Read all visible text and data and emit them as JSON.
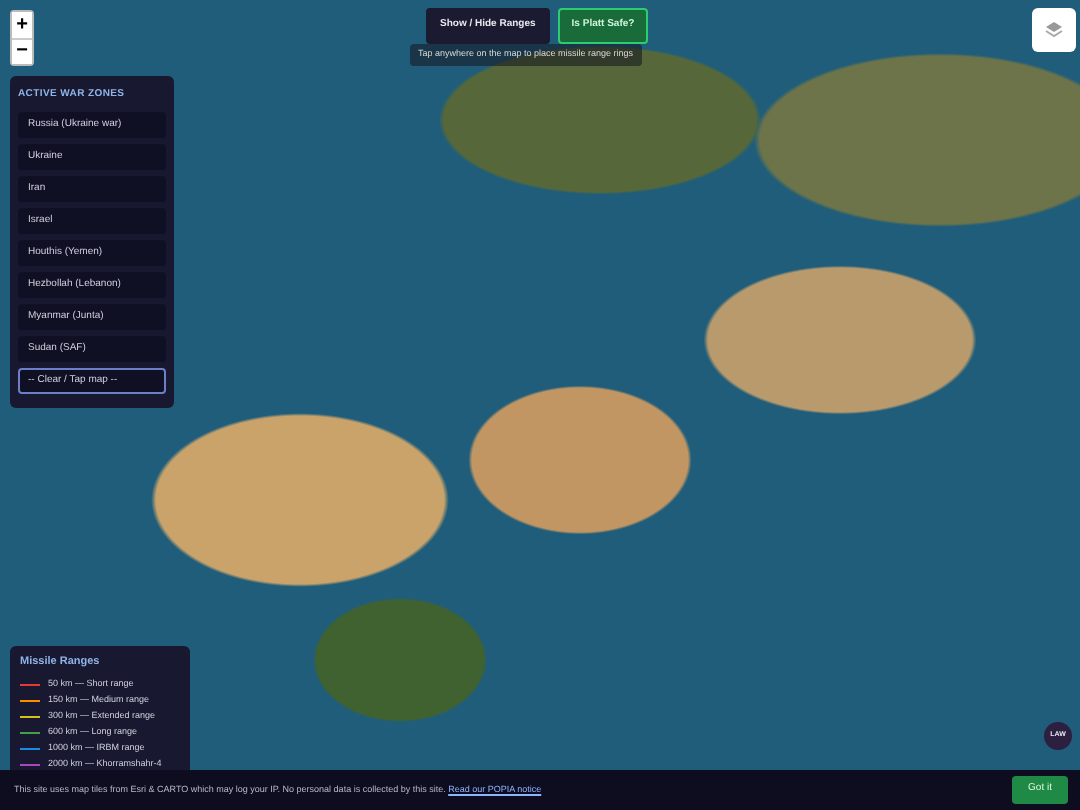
{
  "zoom_controls": [
    "+",
    "−"
  ],
  "top_buttons": [
    {
      "label": "Show / Hide Ranges",
      "kind": "plain"
    },
    {
      "label": "Is Platt Safe?",
      "kind": "green"
    }
  ],
  "hint": "Tap anywhere on the map to place missile range rings",
  "war_zones": {
    "title": "ACTIVE WAR ZONES",
    "items": [
      {
        "label": "Russia (Ukraine war)",
        "selected": false
      },
      {
        "label": "Ukraine",
        "selected": false
      },
      {
        "label": "Iran",
        "selected": false
      },
      {
        "label": "Israel",
        "selected": false
      },
      {
        "label": "Houthis (Yemen)",
        "selected": false
      },
      {
        "label": "Hezbollah (Lebanon)",
        "selected": false
      },
      {
        "label": "Myanmar (Junta)",
        "selected": false
      },
      {
        "label": "Sudan (SAF)",
        "selected": false
      },
      {
        "label": "-- Clear / Tap map --",
        "selected": true
      }
    ]
  },
  "legend": {
    "title": "Missile Ranges",
    "items": [
      {
        "label": "50 km — Short range",
        "color": "#e53935"
      },
      {
        "label": "150 km — Medium range",
        "color": "#fb8c00"
      },
      {
        "label": "300 km — Extended range",
        "color": "#d4c21a"
      },
      {
        "label": "600 km — Long range",
        "color": "#43a047"
      },
      {
        "label": "1000 km — IRBM range",
        "color": "#1e88e5"
      },
      {
        "label": "2000 km — Khorramshahr-4",
        "color": "#ab47bc"
      }
    ]
  },
  "law_badge": "LAW",
  "cookie_bar": {
    "text": "This site uses map tiles from Esri & CARTO which may log your IP. No personal data is collected by this site.",
    "link": "Read our POPIA notice",
    "button": "Got it"
  }
}
